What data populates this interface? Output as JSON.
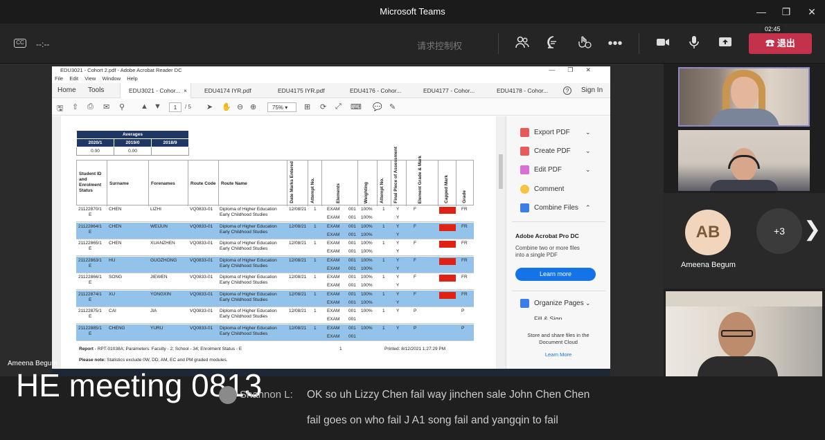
{
  "window": {
    "title": "Microsoft Teams"
  },
  "toolbar": {
    "timer": "--:--",
    "request_control": "请求控制权",
    "leave_label": "退出",
    "countdown": "02:45"
  },
  "pdf": {
    "title": "EDU3021 - Cohort 2.pdf - Adobe Acrobat Reader DC",
    "menu": [
      "File",
      "Edit",
      "View",
      "Window",
      "Help"
    ],
    "home": "Home",
    "tools": "Tools",
    "tabs": [
      "EDU3021 - Cohor...",
      "EDU4174 IYR.pdf",
      "EDU4175 IYR.pdf",
      "EDU4176 - Cohor...",
      "EDU4177 - Cohor...",
      "EDU4178 - Cohor..."
    ],
    "sign_in": "Sign In",
    "page_current": "1",
    "page_total": "/ 5",
    "zoom": "75%",
    "averages": {
      "header": "Averages",
      "cols": [
        "2020/1",
        "2019/0",
        "2018/9"
      ],
      "vals": [
        "0.00",
        "0.00",
        ""
      ]
    },
    "columns": {
      "student": "Student ID and Enrolment Status",
      "surname": "Surname",
      "forenames": "Forenames",
      "route_code": "Route Code",
      "route_name": "Route Name",
      "date": "Date Marks Entered",
      "attempt": "Attempt No.",
      "elements": "Elements",
      "weighting": "Weighting",
      "attempt2": "Attempt No.",
      "final_piece": "Final Piece of Assessment",
      "grade_mark": "Element Grade & Mark",
      "capped": "Capped Mark",
      "grade": "Grade"
    },
    "rows": [
      {
        "id1": "21122870/1",
        "id2": "E",
        "surname": "CHEN",
        "forename": "LIZHI",
        "code": "VQ0833-01",
        "name1": "Diploma of Higher Education",
        "name2": "Early Childhood Studies",
        "date": "12/08/21",
        "att": "1",
        "el": "EXAM",
        "num": "001",
        "w1": "100%",
        "w2": "100%",
        "att2": "1",
        "fin1": "Y",
        "fin2": "Y",
        "eg": "F",
        "grade": "FR"
      },
      {
        "id1": "21122864/1",
        "id2": "E",
        "surname": "CHEN",
        "forename": "WEIJUN",
        "code": "VQ0833-01",
        "name1": "Diploma of Higher Education",
        "name2": "Early Childhood Studies",
        "date": "12/08/21",
        "att": "1",
        "el": "EXAM",
        "num": "001",
        "w1": "100%",
        "w2": "100%",
        "att2": "1",
        "fin1": "Y",
        "fin2": "Y",
        "eg": "F",
        "grade": "FR"
      },
      {
        "id1": "21122865/1",
        "id2": "E",
        "surname": "CHEN",
        "forename": "XUANZHEN",
        "code": "VQ0833-01",
        "name1": "Diploma of Higher Education",
        "name2": "Early Childhood Studies",
        "date": "12/08/21",
        "att": "1",
        "el": "EXAM",
        "num": "001",
        "w1": "100%",
        "w2": "100%",
        "att2": "1",
        "fin1": "Y",
        "fin2": "Y",
        "eg": "F",
        "grade": "FR"
      },
      {
        "id1": "21122863/1",
        "id2": "E",
        "surname": "HU",
        "forename": "GUOZHONG",
        "code": "VQ0833-01",
        "name1": "Diploma of Higher Education",
        "name2": "Early Childhood Studies",
        "date": "12/08/21",
        "att": "1",
        "el": "EXAM",
        "num": "001",
        "w1": "100%",
        "w2": "100%",
        "att2": "1",
        "fin1": "Y",
        "fin2": "Y",
        "eg": "F",
        "grade": "FR"
      },
      {
        "id1": "21122866/1",
        "id2": "E",
        "surname": "SONG",
        "forename": "JIEWEN",
        "code": "VQ0833-01",
        "name1": "Diploma of Higher Education",
        "name2": "Early Childhood Studies",
        "date": "12/08/21",
        "att": "1",
        "el": "EXAM",
        "num": "001",
        "w1": "100%",
        "w2": "100%",
        "att2": "1",
        "fin1": "Y",
        "fin2": "Y",
        "eg": "F",
        "grade": "FR"
      },
      {
        "id1": "21122874/1",
        "id2": "E",
        "surname": "XU",
        "forename": "YONGXIN",
        "code": "VQ0833-01",
        "name1": "Diploma of Higher Education",
        "name2": "Early Childhood Studies",
        "date": "12/08/21",
        "att": "1",
        "el": "EXAM",
        "num": "001",
        "w1": "100%",
        "w2": "100%",
        "att2": "1",
        "fin1": "Y",
        "fin2": "Y",
        "eg": "F",
        "grade": "FR"
      },
      {
        "id1": "21122875/1",
        "id2": "E",
        "surname": "CAI",
        "forename": "JIA",
        "code": "VQ0833-01",
        "name1": "Diploma of Higher Education",
        "name2": "Early Childhood Studies",
        "date": "12/08/21",
        "att": "1",
        "el": "EXAM",
        "num": "001",
        "w1": "100%",
        "w2": "",
        "att2": "1",
        "fin1": "Y",
        "fin2": "",
        "eg": "P",
        "grade": "P"
      },
      {
        "id1": "21122885/1",
        "id2": "E",
        "surname": "CHENG",
        "forename": "YURU",
        "code": "VQ0833-01",
        "name1": "Diploma of Higher Education",
        "name2": "Early Childhood Studies",
        "date": "12/08/21",
        "att": "1",
        "el": "EXAM",
        "num": "001",
        "w1": "100%",
        "w2": "",
        "att2": "1",
        "fin1": "Y",
        "fin2": "",
        "eg": "P",
        "grade": "P"
      }
    ],
    "report_label": "Report",
    "report_rest": " - RPT-01038A; Parameters: Faculty - 2; School - 34; Enrolment Status - E",
    "page_num": "1",
    "printed": "Printed: 8/12/2021 1:27:29 PM",
    "notes_label": "Please note:",
    "notes_rest": " Statistics exclude 0W, DD, AM, EC and PM graded modules.",
    "right_panel": {
      "items": [
        "Export PDF",
        "Create PDF",
        "Edit PDF",
        "Comment",
        "Combine Files"
      ],
      "promo_heading": "Adobe Acrobat Pro DC",
      "promo_text": "Combine two or more files into a single PDF",
      "learn_button": "Learn more",
      "organize": "Organize Pages",
      "fill_sign": "Fill & Sign",
      "store_text": "Store and share files in the Document Cloud",
      "learn_more_link": "Learn More"
    }
  },
  "participants": {
    "shared_by": "Ameena Begum",
    "ab_initials": "AB",
    "ab_name": "Ameena Begum",
    "more": "+3"
  },
  "captions": {
    "meeting_title": "HE meeting 0813",
    "speaker": "Shannon L:",
    "line1": "OK so uh Lizzy Chen fail way jinchen sale John Chen Chen",
    "line2": "fail goes on who fail J A1 song fail and yangqin to fail"
  },
  "colors": {
    "leave": "#c4314b",
    "highlight": "#93c3ea",
    "capped": "#e02214",
    "header": "#1e3764"
  }
}
